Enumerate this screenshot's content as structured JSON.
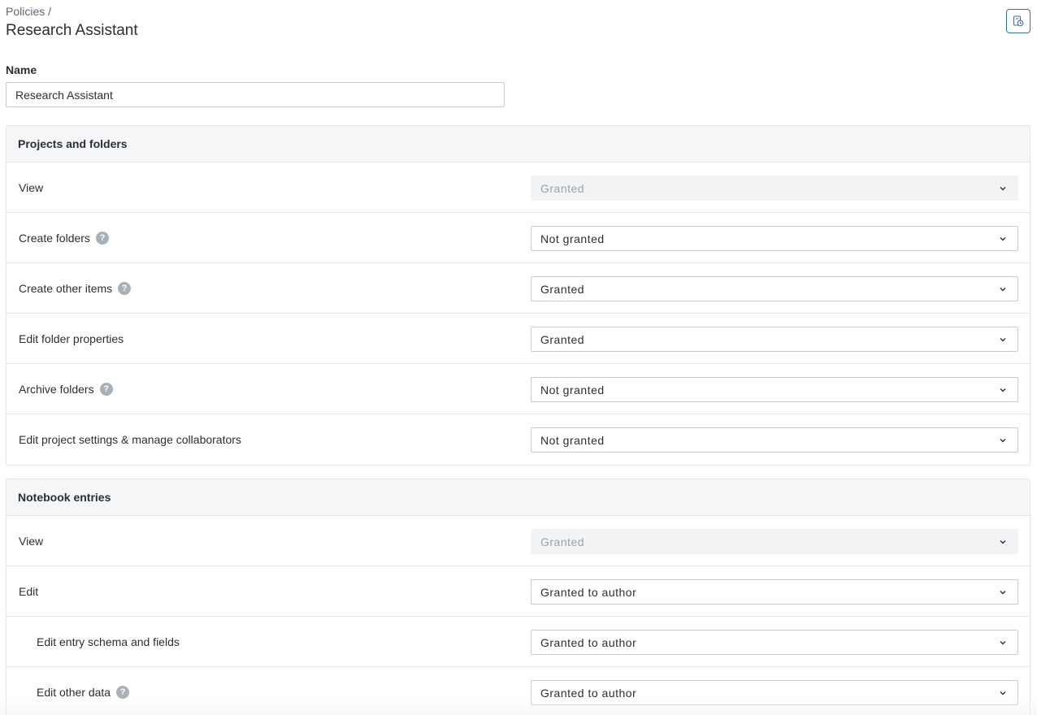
{
  "breadcrumb": {
    "root": "Policies /"
  },
  "title": "Research Assistant",
  "name_field": {
    "label": "Name",
    "value": "Research Assistant"
  },
  "sections": [
    {
      "title": "Projects and folders",
      "rows": [
        {
          "label": "View",
          "value": "Granted"
        },
        {
          "label": "Create folders",
          "value": "Not granted"
        },
        {
          "label": "Create other items",
          "value": "Granted"
        },
        {
          "label": "Edit folder properties",
          "value": "Granted"
        },
        {
          "label": "Archive folders",
          "value": "Not granted"
        },
        {
          "label": "Edit project settings & manage collaborators",
          "value": "Not granted"
        }
      ]
    },
    {
      "title": "Notebook entries",
      "rows": [
        {
          "label": "View",
          "value": "Granted"
        },
        {
          "label": "Edit",
          "value": "Granted to author"
        },
        {
          "label": "Edit entry schema and fields",
          "value": "Granted to author"
        },
        {
          "label": "Edit other data",
          "value": "Granted to author"
        }
      ]
    }
  ],
  "help_glyph": "?",
  "icons": {
    "top_action": "document-history-icon",
    "row_help": "help-icon",
    "dropdown": "chevron-down-icon"
  },
  "colors": {
    "accent": "#2f6fc2",
    "help_icon": "#a9b1b8",
    "disabled_text": "#9aa3ab"
  }
}
